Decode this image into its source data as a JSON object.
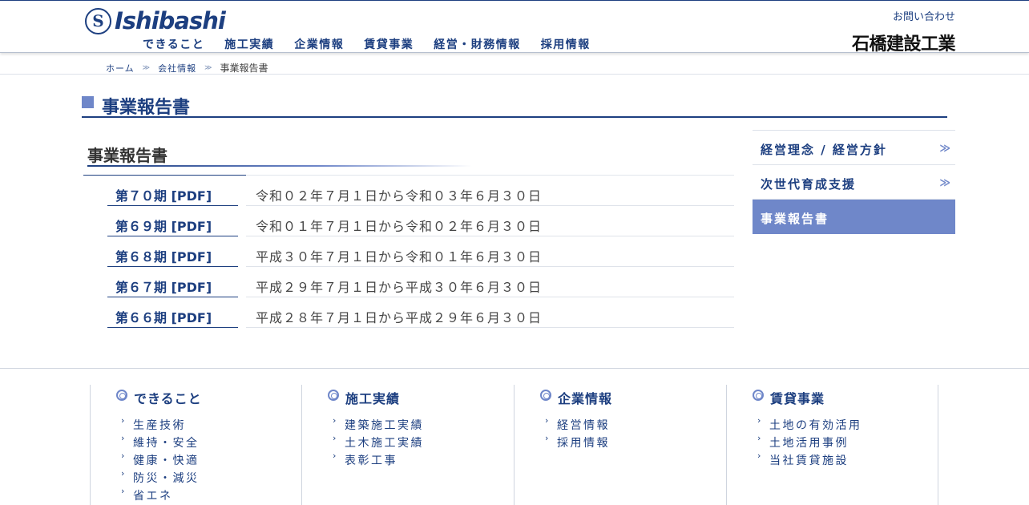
{
  "header": {
    "logo_mark": "S",
    "logo_text": "Ishibashi",
    "contact": "お問い合わせ",
    "company_name": "石橋建設工業",
    "nav": [
      "できること",
      "施工実績",
      "企業情報",
      "賃貸事業",
      "経営・財務情報",
      "採用情報"
    ]
  },
  "breadcrumb": {
    "items": [
      "ホーム",
      "会社情報"
    ],
    "separator": "≫",
    "current": "事業報告書"
  },
  "page_title": "事業報告書",
  "section_title": "事業報告書",
  "reports": [
    {
      "period": "第７０期 [PDF]",
      "range": "令和０２年７月１日から令和０３年６月３０日"
    },
    {
      "period": "第６９期 [PDF]",
      "range": "令和０１年７月１日から令和０２年６月３０日"
    },
    {
      "period": "第６８期 [PDF]",
      "range": "平成３０年７月１日から令和０１年６月３０日"
    },
    {
      "period": "第６７期 [PDF]",
      "range": "平成２９年７月１日から平成３０年６月３０日"
    },
    {
      "period": "第６６期 [PDF]",
      "range": "平成２８年７月１日から平成２９年６月３０日"
    }
  ],
  "sidebar": {
    "items": [
      {
        "label": "経営理念 / 経営方針",
        "arrow": "≫"
      },
      {
        "label": "次世代育成支援",
        "arrow": "≫"
      },
      {
        "label": "事業報告書",
        "arrow": ""
      }
    ],
    "active_index": 2
  },
  "footer": {
    "columns": [
      {
        "title": "できること",
        "links": [
          "生産技術",
          "維持・安全",
          "健康・快適",
          "防災・減災",
          "省エネ"
        ]
      },
      {
        "title": "施工実績",
        "links": [
          "建築施工実績",
          "土木施工実績",
          "表彰工事"
        ]
      },
      {
        "title": "企業情報",
        "links": [
          "経営情報",
          "採用情報"
        ]
      },
      {
        "title": "賃貸事業",
        "links": [
          "土地の有効活用",
          "土地活用事例",
          "当社賃貸施設"
        ]
      }
    ]
  },
  "colors": {
    "brand": "#1d3f80",
    "accent": "#6f87c9",
    "text": "#444444"
  }
}
